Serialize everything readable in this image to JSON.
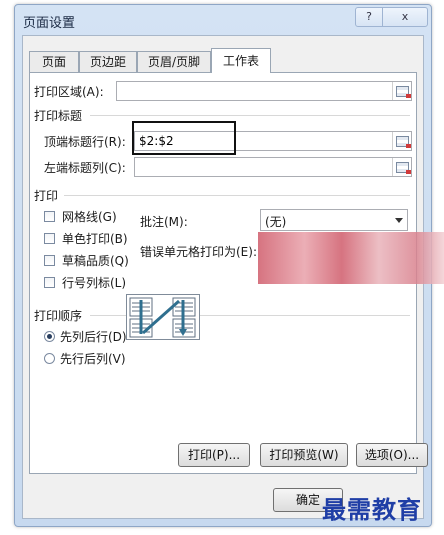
{
  "dialog": {
    "title": "页面设置",
    "help_label": "?",
    "close_label": "x"
  },
  "tabs": [
    {
      "label": "页面"
    },
    {
      "label": "页边距"
    },
    {
      "label": "页眉/页脚"
    },
    {
      "label": "工作表"
    }
  ],
  "print_area": {
    "label": "打印区域(A):",
    "value": ""
  },
  "print_titles": {
    "section_label": "打印标题",
    "rows_label": "顶端标题行(R):",
    "rows_value": "$2:$2",
    "cols_label": "左端标题列(C):",
    "cols_value": ""
  },
  "print": {
    "section_label": "打印",
    "checkboxes": [
      {
        "label": "网格线(G)",
        "checked": false
      },
      {
        "label": "单色打印(B)",
        "checked": false
      },
      {
        "label": "草稿品质(Q)",
        "checked": false
      },
      {
        "label": "行号列标(L)",
        "checked": false
      }
    ],
    "comments_label": "批注(M):",
    "comments_value": "(无)",
    "errors_label": "错误单元格打印为(E):"
  },
  "page_order": {
    "section_label": "打印顺序",
    "options": [
      {
        "label": "先列后行(D)",
        "selected": true
      },
      {
        "label": "先行后列(V)",
        "selected": false
      }
    ]
  },
  "buttons": {
    "print": "打印(P)...",
    "print_preview": "打印预览(W)",
    "options": "选项(O)...",
    "ok": "确定"
  },
  "watermark": "最需教育"
}
